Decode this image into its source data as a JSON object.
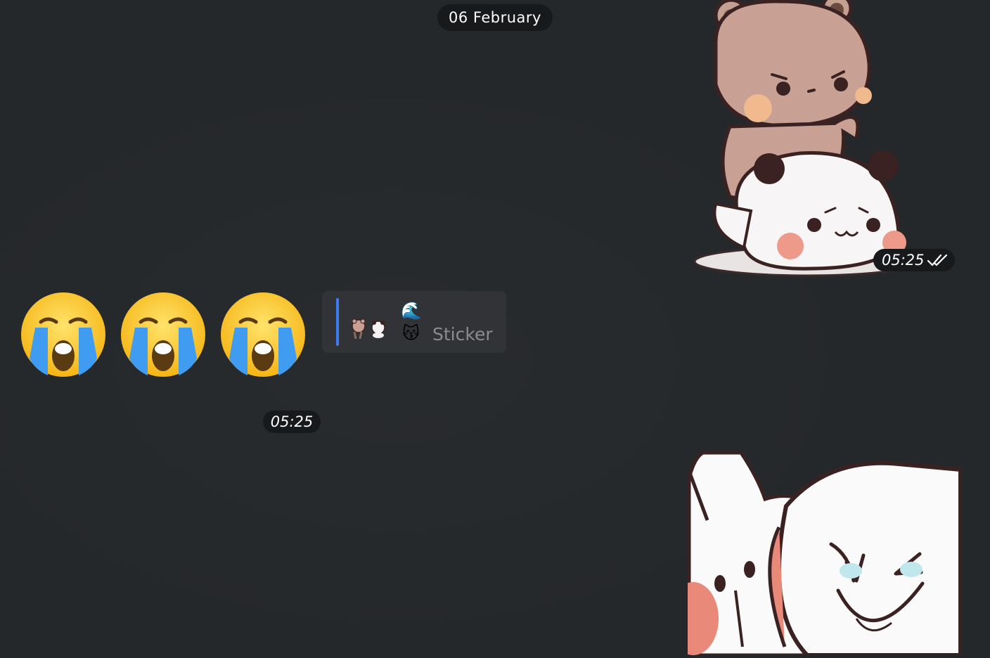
{
  "chat": {
    "date_separator": "06 February",
    "messages": [
      {
        "side": "outgoing",
        "kind": "sticker",
        "sticker_icon": "bear-hugging-panda-sticker",
        "time": "05:25",
        "status_icon": "double-check-icon"
      },
      {
        "side": "incoming",
        "kind": "emoji",
        "emojis": [
          "😭",
          "😭",
          "😭"
        ],
        "time": "05:25",
        "reply": {
          "thumbnail_icon": "bear-panda-sticker-thumbnail",
          "emoji_top": "🌊",
          "emoji_bottom": "😽",
          "label": "Sticker"
        }
      },
      {
        "side": "outgoing",
        "kind": "sticker",
        "sticker_icon": "panda-laughing-sticker"
      }
    ]
  },
  "colors": {
    "background": "#25282b",
    "pill": "#17191b",
    "reply_bar": "#3e7cf0",
    "reply_card": "#313336"
  }
}
